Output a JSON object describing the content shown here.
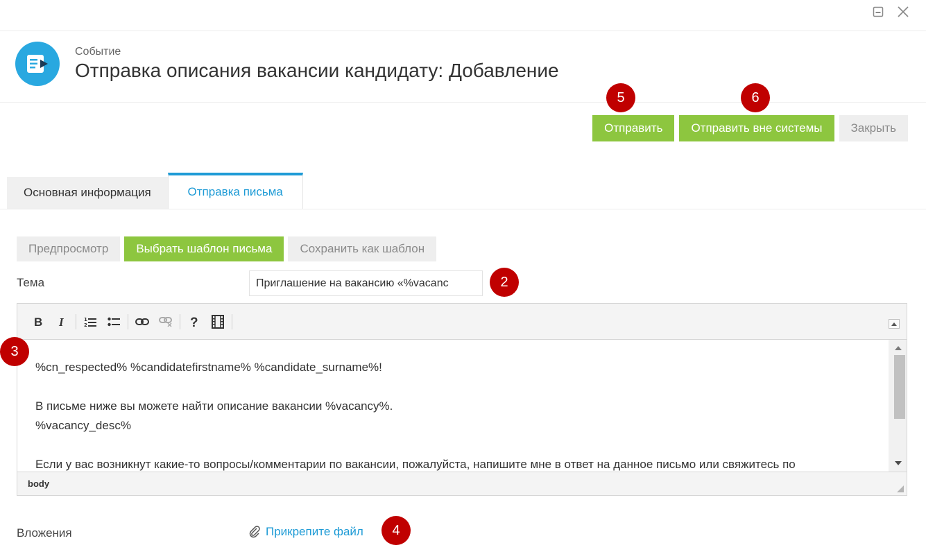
{
  "window": {
    "minimize_icon": "minimize-icon",
    "close_icon": "close-icon"
  },
  "header": {
    "subtitle": "Событие",
    "title": "Отправка описания вакансии кандидату: Добавление",
    "icon": "email-send-icon",
    "icon_color": "#29a8e0"
  },
  "actions": {
    "send": "Отправить",
    "send_outside": "Отправить вне системы",
    "close": "Закрыть"
  },
  "tabs": [
    {
      "label": "Основная информация",
      "active": false
    },
    {
      "label": "Отправка письма",
      "active": true
    }
  ],
  "template_buttons": {
    "preview": "Предпросмотр",
    "choose_template": "Выбрать шаблон письма",
    "save_template": "Сохранить как шаблон"
  },
  "form": {
    "subject_label": "Тема",
    "subject_value": "Приглашение на вакансию «%vacanc",
    "attachments_label": "Вложения",
    "attach_link": "Прикрепите файл"
  },
  "editor": {
    "toolbar": [
      "bold-icon",
      "italic-icon",
      "ordered-list-icon",
      "bullet-list-icon",
      "link-icon",
      "unlink-icon",
      "help-icon",
      "media-icon"
    ],
    "lines": [
      "%cn_respected% %candidatefirstname% %candidate_surname%!",
      "",
      "В письме ниже вы можете найти описание вакансии %vacancy%.",
      "%vacancy_desc%",
      "",
      "Если у вас возникнут какие-то вопросы/комментарии по вакансии, пожалуйста, напишите мне в ответ на данное письмо или свяжитесь по"
    ],
    "status_path": "body"
  },
  "badges": {
    "send": "5",
    "send_outside": "6",
    "subject": "2",
    "editor": "3",
    "attach": "4"
  },
  "colors": {
    "green": "#8dc63f",
    "blue": "#1e9bd6",
    "badge_red": "#c00000"
  }
}
